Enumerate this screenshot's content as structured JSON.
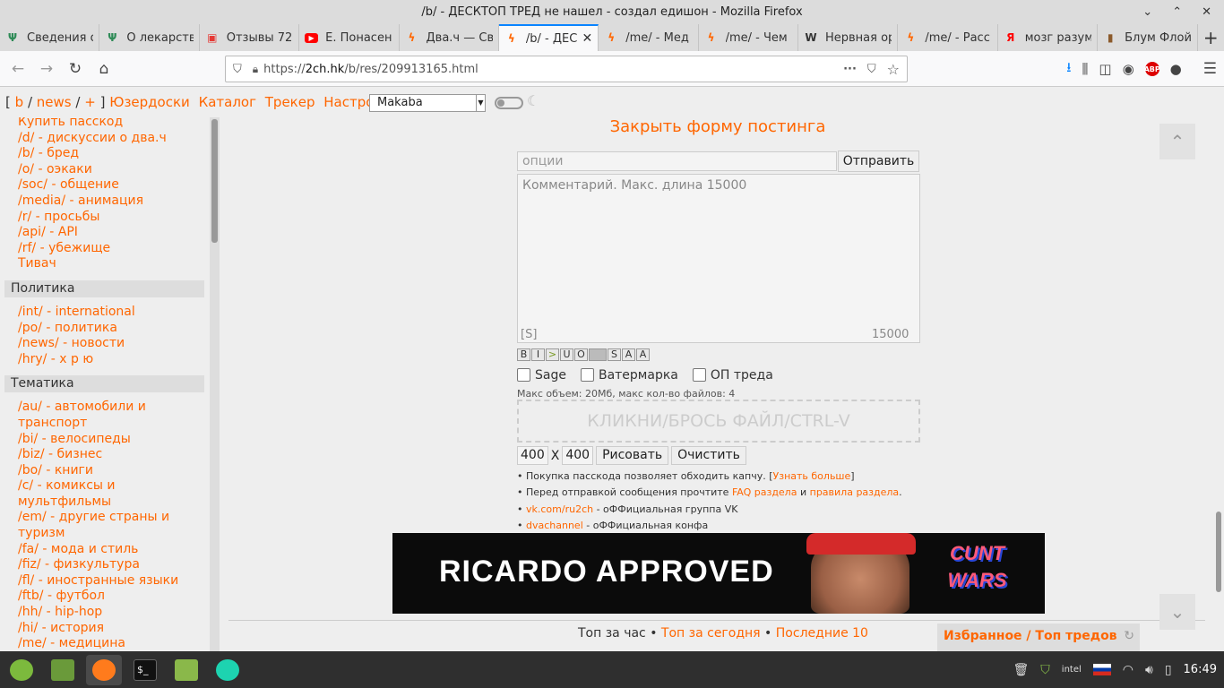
{
  "window": {
    "title": "/b/ - ДЕСКТОП ТРЕД не нашел - создал едишон - Mozilla Firefox"
  },
  "tabs": [
    {
      "label": "Сведения о",
      "icon": "psi-icon",
      "color": "#2e8b57"
    },
    {
      "label": "О лекарств",
      "icon": "psi-icon",
      "color": "#2e8b57"
    },
    {
      "label": "Отзывы 72",
      "icon": "reviews-icon",
      "color": "#e53935"
    },
    {
      "label": "Е. Понасен",
      "icon": "youtube-icon",
      "color": "#ff0000"
    },
    {
      "label": "Два.ч — Св",
      "icon": "lightning-icon",
      "color": "#ff6600"
    },
    {
      "label": "/b/ - ДЕС",
      "icon": "lightning-icon",
      "color": "#ff6600",
      "active": true
    },
    {
      "label": "/me/ - Мед",
      "icon": "lightning-icon",
      "color": "#ff6600"
    },
    {
      "label": "/me/ - Чем",
      "icon": "lightning-icon",
      "color": "#ff6600"
    },
    {
      "label": "Нервная ор",
      "icon": "wikipedia-icon",
      "color": "#333333"
    },
    {
      "label": "/me/ - Расс",
      "icon": "lightning-icon",
      "color": "#ff6600"
    },
    {
      "label": "мозг разум",
      "icon": "yandex-icon",
      "color": "#ff0000"
    },
    {
      "label": "Блум Флой",
      "icon": "book-icon",
      "color": "#8b5a2b"
    }
  ],
  "url": {
    "prefix": "https://",
    "host": "2ch.hk",
    "path": "/b/res/209913165.html"
  },
  "topnav": {
    "open": "[",
    "b": "b",
    "sep": "/",
    "news": "news",
    "plus": "+",
    "close": "]",
    "userboards": "Юзердоски",
    "catalog": "Каталог",
    "tracker": "Трекер",
    "settings": "Настройки",
    "style": "Makaba"
  },
  "sidebar": {
    "top_links": [
      "Купить пасскод",
      "/d/ - дискуссии о два.ч",
      "/b/ - бред",
      "/o/ - оэкаки",
      "/soc/ - общение",
      "/media/ - анимация",
      "/r/ - просьбы",
      "/api/ - API",
      "/rf/ - убежище",
      "Тивач"
    ],
    "politics_title": "Политика",
    "politics_links": [
      "/int/ - international",
      "/po/ - политика",
      "/news/ - новости",
      "/hry/ - х р ю"
    ],
    "thematic_title": "Тематика",
    "thematic_links": [
      "/au/ - автомобили и транспорт",
      "/bi/ - велосипеды",
      "/biz/ - бизнес",
      "/bo/ - книги",
      "/c/ - комиксы и мультфильмы",
      "/em/ - другие страны и туризм",
      "/fa/ - мода и стиль",
      "/fiz/ - физкультура",
      "/fl/ - иностранные языки",
      "/ftb/ - футбол",
      "/hh/ - hip-hop",
      "/hi/ - история",
      "/me/ - медицина"
    ]
  },
  "form": {
    "close_label": "Закрыть форму постинга",
    "options_placeholder": "опции",
    "send_label": "Отправить",
    "comment_placeholder": "Комментарий. Макс. длина 15000",
    "spoiler": "[S]",
    "counter": "15000",
    "format_buttons": [
      "B",
      "I",
      ">",
      "U",
      "O",
      "",
      "S",
      "A",
      "A"
    ],
    "sage": "Sage",
    "watermark": "Ватермарка",
    "op": "ОП треда",
    "max_size": "Макс объем: 20Мб, макс кол-во файлов: 4",
    "dropzone": "КЛИКНИ/БРОСЬ ФАЙЛ/CTRL-V",
    "width": "400",
    "x": "X",
    "height": "400",
    "draw": "Рисовать",
    "clear": "Очистить"
  },
  "notes": {
    "n1_pre": "• Покупка пасскода позволяет обходить капчу. [",
    "n1_link": "Узнать больше",
    "n1_post": "]",
    "n2_pre": "• Перед отправкой сообщения прочтите ",
    "n2_link1": "FAQ раздела",
    "n2_mid": " и ",
    "n2_link2": "правила раздела",
    "n2_post": ".",
    "n3_bullet": "• ",
    "n3_link": "vk.com/ru2ch",
    "n3_text": " - оФФициальная группа VK",
    "n4_bullet": "• ",
    "n4_link": "dvachannel",
    "n4_text": " - оФФициальная конфа"
  },
  "banner": {
    "text": "RICARDO APPROVED",
    "logo_line1": "CUNT",
    "logo_line2": "WARS"
  },
  "bottom": {
    "top_hour": "Топ за час",
    "bullet": " • ",
    "top_today": "Топ за сегодня",
    "last10": "Последние 10",
    "favorites": "Избранное / Топ тредов"
  },
  "tray": {
    "clock": "16:49"
  },
  "colors": {
    "accent": "#ff6600",
    "firefox_blue": "#0a84ff",
    "taskbar": "#2f2f2f"
  }
}
